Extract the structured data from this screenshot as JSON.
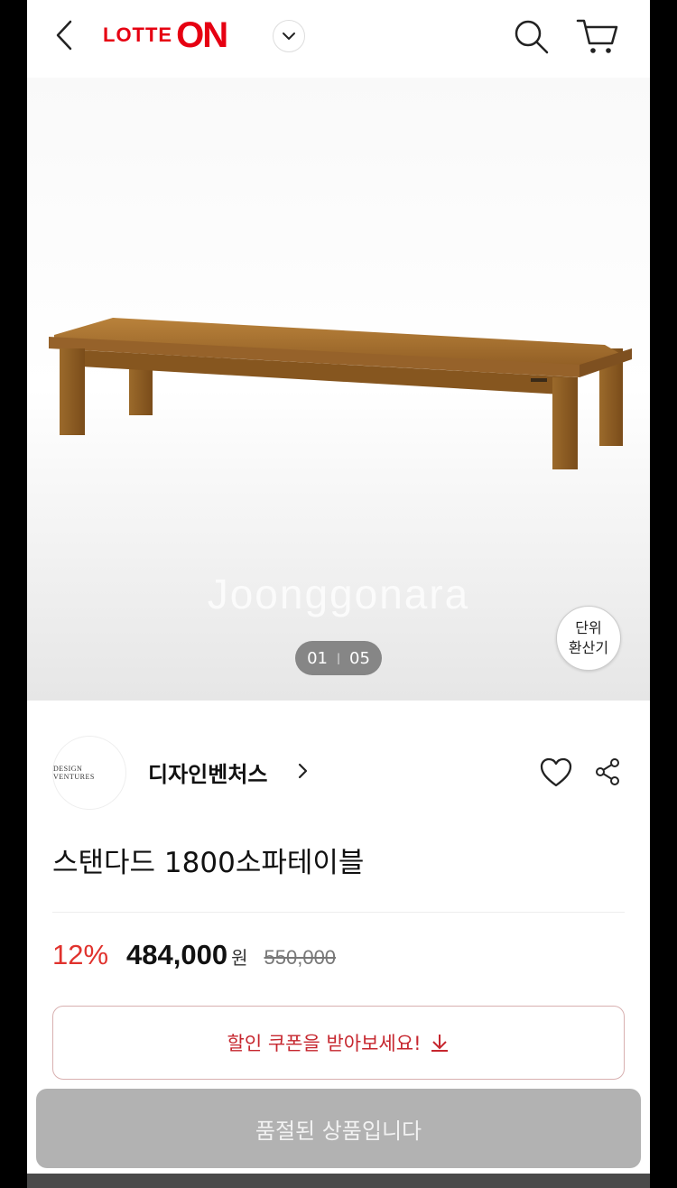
{
  "header": {
    "back_icon": "chevron-left-icon",
    "logo_text_1": "LOTTE",
    "logo_text_2": "ON",
    "brand_color": "#e60012"
  },
  "gallery": {
    "watermark": "Joonggonara",
    "current": "01",
    "separator": "|",
    "total": "05",
    "unit_convert_line1": "단위",
    "unit_convert_line2": "환산기"
  },
  "seller": {
    "logo_text": "DESIGN VENTURES",
    "name": "디자인벤처스"
  },
  "product": {
    "title": "스탠다드 1800소파테이블",
    "discount": "12%",
    "price": "484,000",
    "currency": "원",
    "original_price": "550,000"
  },
  "coupon": {
    "label": "할인 쿠폰을 받아보세요!"
  },
  "purchase": {
    "soldout_label": "품절된 상품입니다"
  },
  "colors": {
    "accent": "#e0322d",
    "coupon_text": "#c6262e",
    "soldout_bg": "#b2b2b2"
  }
}
